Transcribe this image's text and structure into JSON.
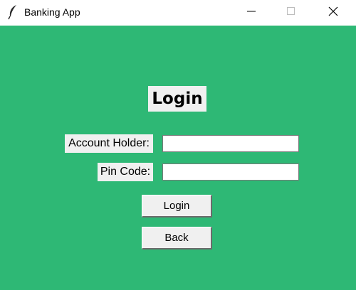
{
  "window": {
    "title": "Banking App",
    "app_icon": "feather-icon",
    "controls": [
      "minimize-icon",
      "maximize-icon",
      "close-icon"
    ]
  },
  "colors": {
    "background": "#2eb875",
    "widget": "#f0f0f0"
  },
  "login": {
    "heading": "Login",
    "account_holder_label": "Account Holder:",
    "account_holder_value": "",
    "pin_label": "Pin Code:",
    "pin_value": "",
    "login_button": "Login",
    "back_button": "Back"
  }
}
